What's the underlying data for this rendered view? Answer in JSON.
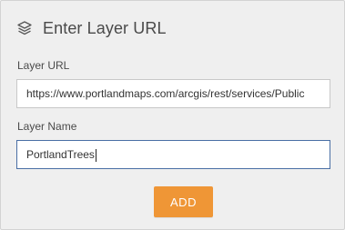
{
  "dialog": {
    "title": "Enter Layer URL",
    "title_icon": "layers-icon"
  },
  "fields": {
    "url": {
      "label": "Layer URL",
      "value": "https://www.portlandmaps.com/arcgis/rest/services/Public"
    },
    "name": {
      "label": "Layer Name",
      "value": "PortlandTrees"
    }
  },
  "actions": {
    "add_label": "ADD"
  },
  "colors": {
    "panel_background": "#efefef",
    "accent_button": "#ef9636",
    "focused_border": "#4a6fa5"
  }
}
